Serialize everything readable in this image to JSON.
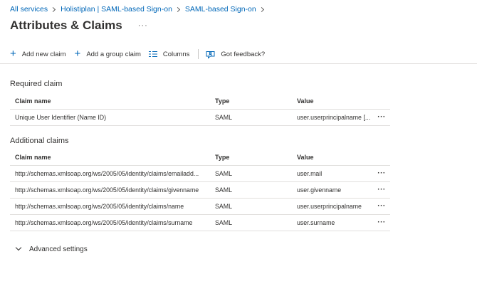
{
  "breadcrumb": [
    "All services",
    "Holistiplan | SAML-based Sign-on",
    "SAML-based Sign-on"
  ],
  "page_title": "Attributes & Claims",
  "title_more": "···",
  "toolbar": {
    "add_new_claim": "Add new claim",
    "add_group_claim": "Add a group claim",
    "columns": "Columns",
    "feedback": "Got feedback?"
  },
  "required": {
    "title": "Required claim",
    "headers": {
      "name": "Claim name",
      "type": "Type",
      "value": "Value"
    },
    "rows": [
      {
        "name": "Unique User Identifier (Name ID)",
        "type": "SAML",
        "value": "user.userprincipalname [..."
      }
    ]
  },
  "additional": {
    "title": "Additional claims",
    "headers": {
      "name": "Claim name",
      "type": "Type",
      "value": "Value"
    },
    "rows": [
      {
        "name": "http://schemas.xmlsoap.org/ws/2005/05/identity/claims/emailadd...",
        "type": "SAML",
        "value": "user.mail"
      },
      {
        "name": "http://schemas.xmlsoap.org/ws/2005/05/identity/claims/givenname",
        "type": "SAML",
        "value": "user.givenname"
      },
      {
        "name": "http://schemas.xmlsoap.org/ws/2005/05/identity/claims/name",
        "type": "SAML",
        "value": "user.userprincipalname"
      },
      {
        "name": "http://schemas.xmlsoap.org/ws/2005/05/identity/claims/surname",
        "type": "SAML",
        "value": "user.surname"
      }
    ]
  },
  "row_more": "···",
  "advanced_settings": "Advanced settings",
  "icons": {
    "add_claim": "plus-icon",
    "add_group": "plus-icon",
    "columns": "columns-icon",
    "feedback": "feedback-icon",
    "expand": "chevron-down-icon"
  },
  "colors": {
    "link": "#0067b8",
    "text": "#323130",
    "border": "#e1dfdd"
  }
}
